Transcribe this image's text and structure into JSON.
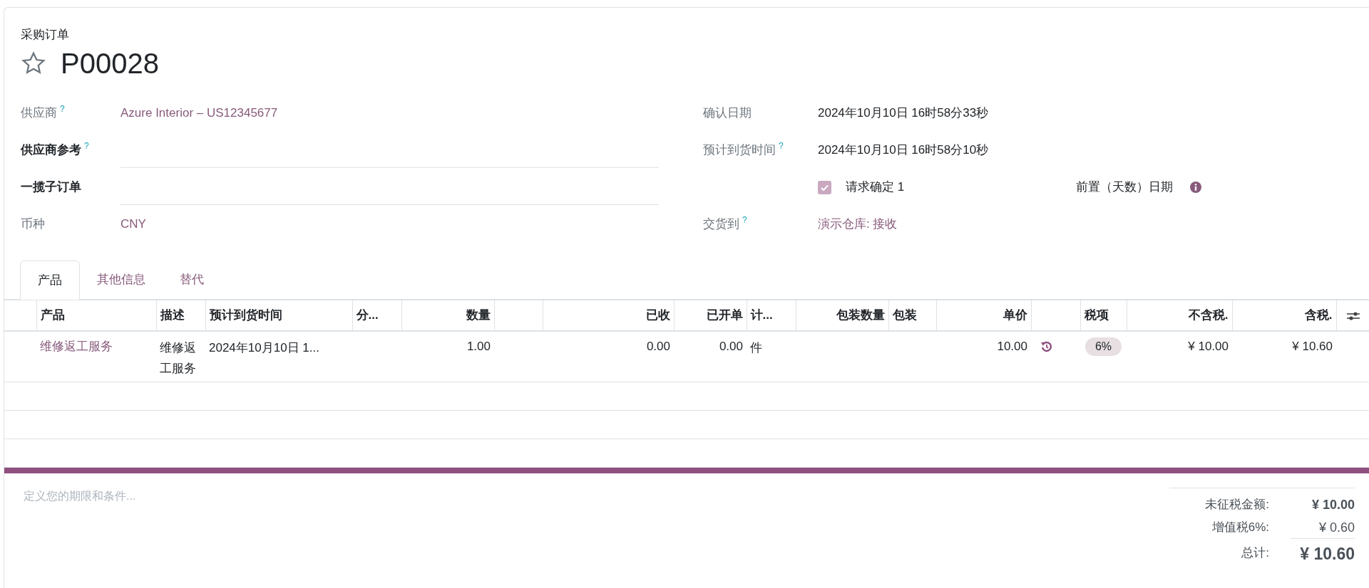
{
  "header": {
    "breadcrumb": "采购订单",
    "title": "P00028",
    "starred": false
  },
  "left_fields": [
    {
      "kind": "link",
      "label": "供应商",
      "help": "?",
      "value": "Azure Interior – US12345677"
    },
    {
      "kind": "input",
      "label": "供应商参考",
      "help": "?"
    },
    {
      "kind": "input",
      "label": "一揽子订单"
    },
    {
      "kind": "link",
      "label": "币种",
      "value": "CNY"
    }
  ],
  "right_fields": [
    {
      "kind": "text",
      "label": "确认日期",
      "value": "2024年10月10日 16时58分33秒"
    },
    {
      "kind": "text",
      "label": "预计到货时间",
      "help": "?",
      "value": "2024年10月10日 16时58分10秒"
    },
    {
      "kind": "checkbox",
      "checked": true,
      "value": "请求确定 1",
      "extra": "前置（天数）日期"
    },
    {
      "kind": "link",
      "label": "交货到",
      "help": "?",
      "value": "演示仓库: 接收"
    }
  ],
  "tabs": [
    {
      "label": "产品",
      "selected": true
    },
    {
      "label": "其他信息",
      "selected": false
    },
    {
      "label": "替代",
      "selected": false
    }
  ],
  "table": {
    "columns": [
      {
        "label": "产品",
        "kind": "link"
      },
      {
        "label": "描述",
        "kind": "text"
      },
      {
        "label": "预计到货时间",
        "kind": "text"
      },
      {
        "label": "分...",
        "kind": "text"
      },
      {
        "label": "数量",
        "kind": "number"
      },
      {
        "label": "已收",
        "kind": "number"
      },
      {
        "label": "已开单",
        "kind": "number"
      },
      {
        "label": "计...",
        "kind": "text"
      },
      {
        "label": "包装数量",
        "kind": "number"
      },
      {
        "label": "包装",
        "kind": "text"
      },
      {
        "label": "单价",
        "kind": "number"
      },
      {
        "label": "税项",
        "kind": "tag"
      },
      {
        "label": "不含税.",
        "kind": "number"
      },
      {
        "label": "含税.",
        "kind": "number"
      }
    ],
    "rows": [
      {
        "cells": [
          "维修返工服务",
          "维修返工服务",
          "2024年10月10日 1...",
          null,
          "1.00",
          "0.00",
          "0.00",
          "件",
          null,
          null,
          "10.00",
          "6%",
          "¥ 10.00",
          "¥ 10.60"
        ]
      }
    ]
  },
  "notes": {
    "placeholder": "定义您的期限和条件..."
  },
  "totals": [
    {
      "kind": "subtotal",
      "label": "未征税金额:",
      "value": "¥ 10.00"
    },
    {
      "kind": "tax",
      "label": "增值税6%:",
      "value": "¥ 0.60"
    },
    {
      "kind": "total",
      "label": "总计:",
      "value": "¥ 10.60"
    }
  ]
}
